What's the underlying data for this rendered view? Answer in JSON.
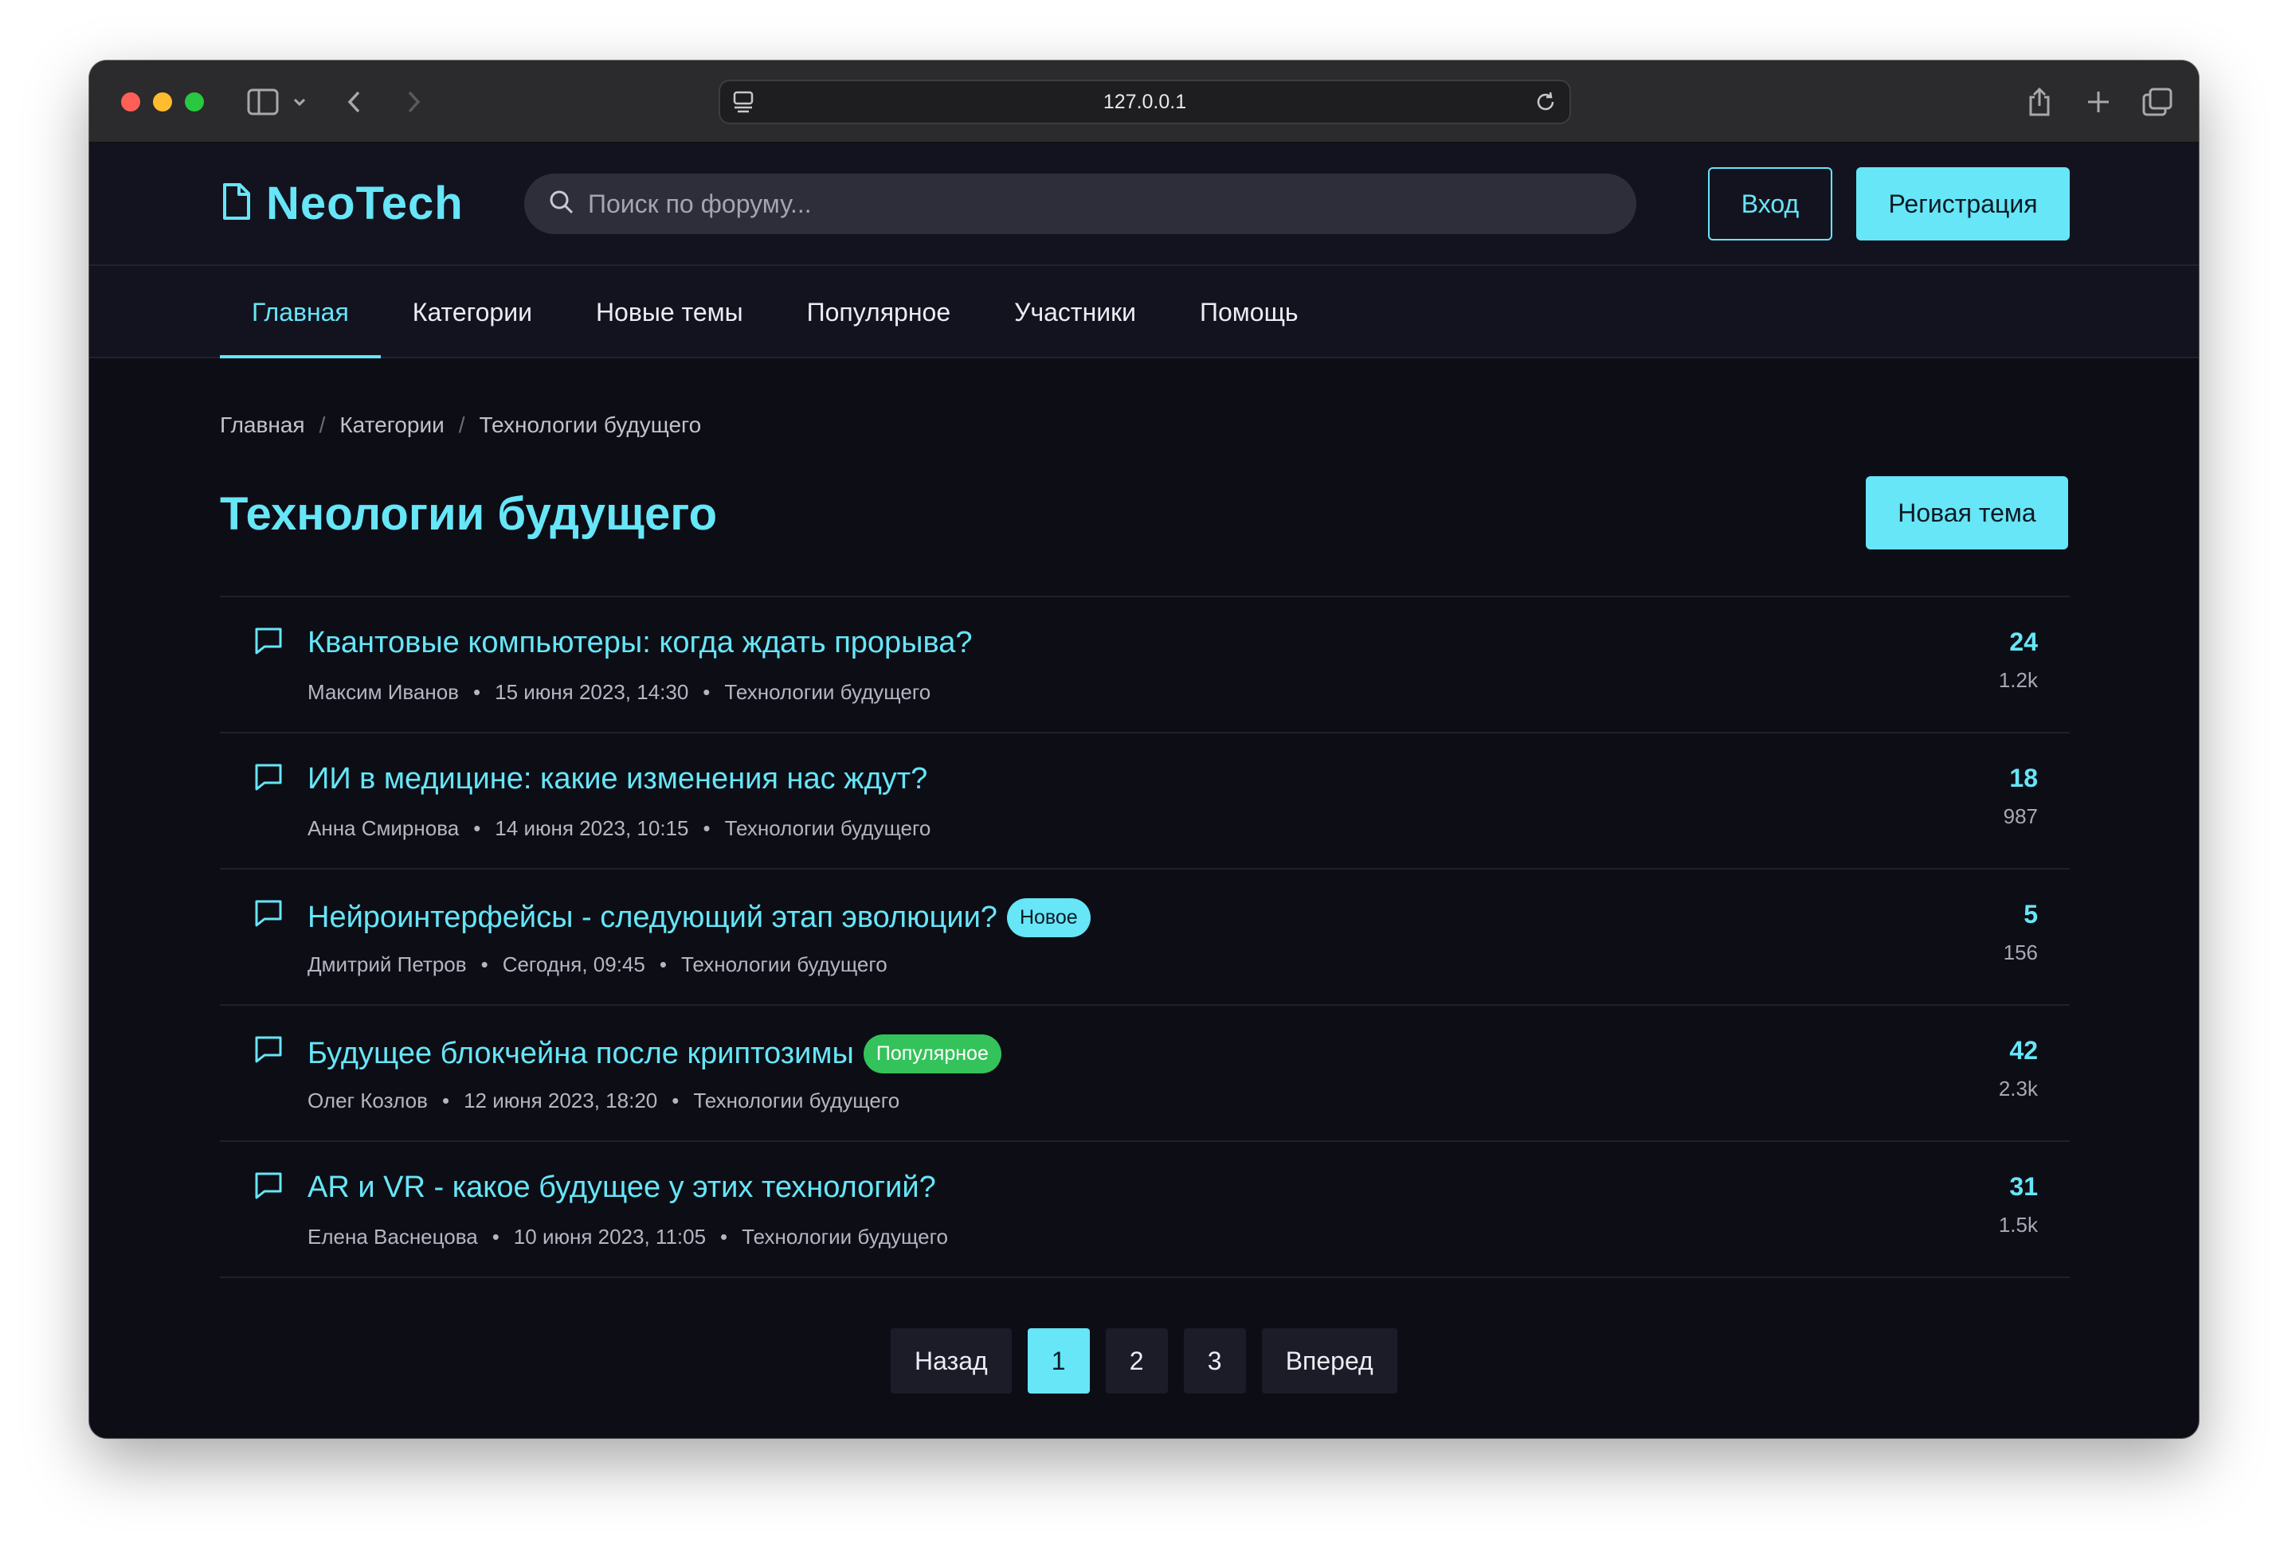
{
  "browser": {
    "url": "127.0.0.1"
  },
  "header": {
    "logo_text": "NeoTech",
    "search_placeholder": "Поиск по форуму...",
    "login_label": "Вход",
    "register_label": "Регистрация"
  },
  "nav": {
    "items": [
      {
        "label": "Главная",
        "active": true
      },
      {
        "label": "Категории"
      },
      {
        "label": "Новые темы"
      },
      {
        "label": "Популярное"
      },
      {
        "label": "Участники"
      },
      {
        "label": "Помощь"
      }
    ]
  },
  "breadcrumb": [
    "Главная",
    "Категории",
    "Технологии будущего"
  ],
  "page": {
    "title": "Технологии будущего",
    "new_topic_label": "Новая тема"
  },
  "topics": [
    {
      "title": "Квантовые компьютеры: когда ждать прорыва?",
      "author": "Максим Иванов",
      "date": "15 июня 2023, 14:30",
      "category": "Технологии будущего",
      "replies": "24",
      "views": "1.2k",
      "badge": ""
    },
    {
      "title": "ИИ в медицине: какие изменения нас ждут?",
      "author": "Анна Смирнова",
      "date": "14 июня 2023, 10:15",
      "category": "Технологии будущего",
      "replies": "18",
      "views": "987",
      "badge": ""
    },
    {
      "title": "Нейроинтерфейсы - следующий этап эволюции?",
      "author": "Дмитрий Петров",
      "date": "Сегодня, 09:45",
      "category": "Технологии будущего",
      "replies": "5",
      "views": "156",
      "badge": "Новое"
    },
    {
      "title": "Будущее блокчейна после криптозимы",
      "author": "Олег Козлов",
      "date": "12 июня 2023, 18:20",
      "category": "Технологии будущего",
      "replies": "42",
      "views": "2.3k",
      "badge": "Популярное"
    },
    {
      "title": "AR и VR - какое будущее у этих технологий?",
      "author": "Елена Васнецова",
      "date": "10 июня 2023, 11:05",
      "category": "Технологии будущего",
      "replies": "31",
      "views": "1.5k",
      "badge": ""
    }
  ],
  "pagination": {
    "prev_label": "Назад",
    "pages": [
      "1",
      "2",
      "3"
    ],
    "current": "1",
    "next_label": "Вперед"
  },
  "colors": {
    "accent": "#66e6f7",
    "background": "#0d0d16",
    "header_bg": "#13131f",
    "badge_popular": "#34c25a"
  }
}
